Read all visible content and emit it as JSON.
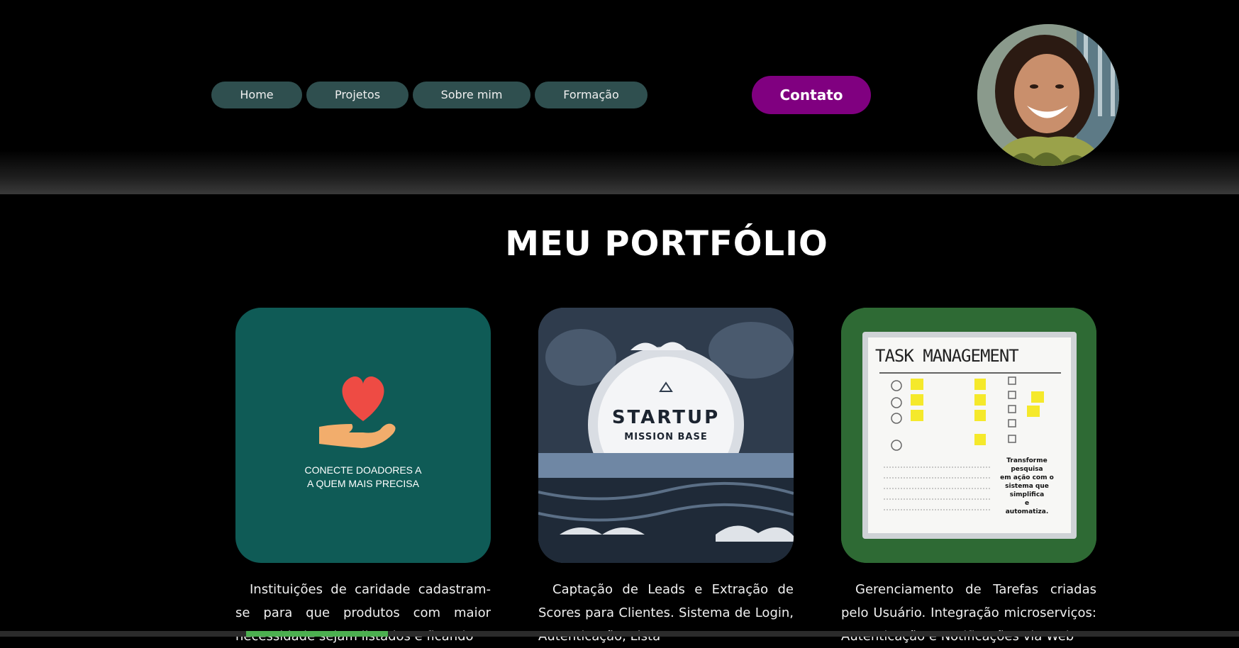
{
  "nav": {
    "items": [
      {
        "label": "Home"
      },
      {
        "label": "Projetos"
      },
      {
        "label": "Sobre mim"
      },
      {
        "label": "Formação"
      }
    ],
    "contact_label": "Contato"
  },
  "main": {
    "title": "MEU PORTFÓLIO",
    "cards": [
      {
        "image_caption_line1": "CONECTE DOADORES A",
        "image_caption_line2": "A QUEM MAIS PRECISA",
        "description": "Instituições de caridade cadastram-se para que produtos com maior necessidade sejam listados e ficando"
      },
      {
        "image_title": "STARTUP",
        "image_subtitle": "MISSION BASE",
        "description": "Captação de Leads e Extração de Scores para Clientes. Sistema de Login, Autenticação, Lista"
      },
      {
        "image_title": "TASK MANAGEMENT",
        "image_note_lines": [
          "Transforme pesquisa",
          "em ação com o",
          "sistema que",
          "simplifica",
          "e",
          "automatiza."
        ],
        "description": "Gerenciamento de Tarefas criadas pelo Usuário. Integração microserviços: Autenticação e Notificações via Web"
      }
    ]
  },
  "colors": {
    "nav_button": "#2f4f4f",
    "contact_button": "#800080",
    "card1_bg": "#0f5b56",
    "background": "#000000"
  }
}
